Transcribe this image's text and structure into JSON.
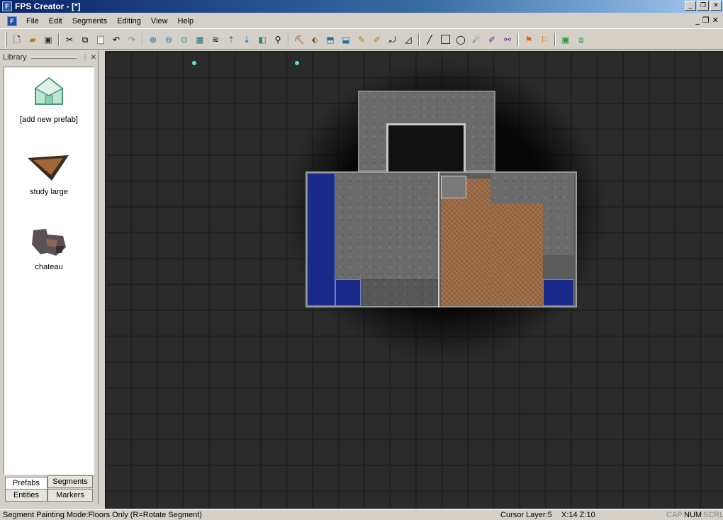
{
  "window": {
    "title": "FPS Creator - [*]",
    "app_icon": "fps-creator-icon"
  },
  "menu": {
    "items": [
      "File",
      "Edit",
      "Segments",
      "Editing",
      "View",
      "Help"
    ]
  },
  "toolbar": {
    "buttons": [
      "new-file-icon",
      "open-file-icon",
      "save-icon",
      "cut-icon",
      "copy-icon",
      "paste-icon",
      "undo-icon",
      "redo-icon",
      "zoom-in-icon",
      "zoom-out-icon",
      "zoom-reset-icon",
      "map-icon",
      "layers-icon",
      "layer-up-icon",
      "layer-down-icon",
      "view-icon",
      "search-icon",
      "segment-pick-icon",
      "segment-paint-icon",
      "floor-paint-icon",
      "wall-paint-icon",
      "brush-icon",
      "draw-icon",
      "rotate-icon",
      "select-box-icon",
      "line-icon",
      "rectangle-icon",
      "circle-icon",
      "entity-icon",
      "entity-edit-icon",
      "entity-link-icon",
      "flag-icon",
      "flag-multi-icon",
      "test-game-icon",
      "build-game-icon"
    ]
  },
  "library": {
    "title": "Library",
    "items": [
      {
        "label": "[add new prefab]",
        "icon": "house-prefab-icon"
      },
      {
        "label": "study large",
        "icon": "study-prefab-icon"
      },
      {
        "label": "chateau",
        "icon": "chateau-prefab-icon"
      }
    ],
    "tabs": [
      "Prefabs",
      "Segments",
      "Entities",
      "Markers"
    ],
    "active_tab": "Prefabs"
  },
  "status": {
    "mode": "Segment Painting Mode:Floors Only (R=Rotate Segment)",
    "cursor_layer": "Cursor Layer:5",
    "coords": "X:14  Z:10",
    "cap": "CAP",
    "num": "NUM",
    "scrl": "SCRL"
  },
  "colors": {
    "titlebar": "#0a246a",
    "grid": "#2b2b2b",
    "marker": "#4de3d8"
  }
}
